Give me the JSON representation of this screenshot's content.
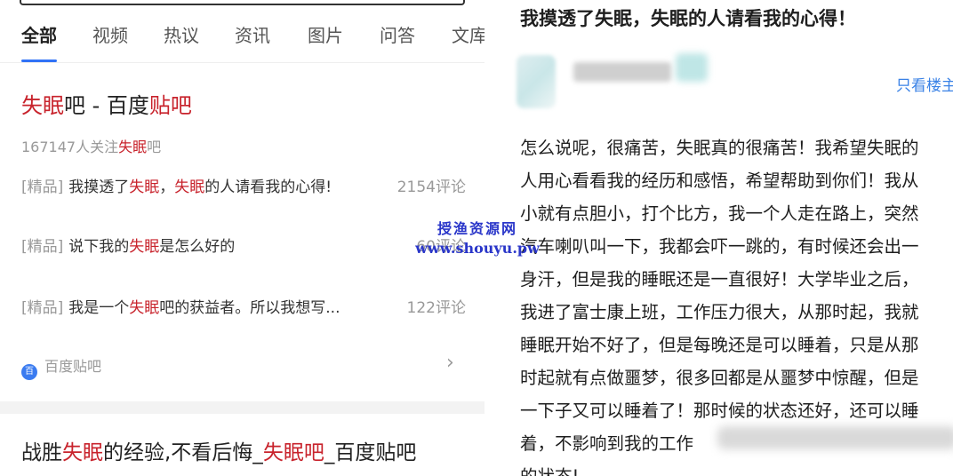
{
  "left": {
    "tabs": [
      "全部",
      "视频",
      "热议",
      "资讯",
      "图片",
      "问答",
      "文库"
    ],
    "result1": {
      "title": {
        "keyword": "失眠",
        "rest": "吧 - 百度",
        "highlight": "贴吧"
      },
      "followers": {
        "count_text": "167147人关注",
        "keyword": "失眠",
        "suffix": "吧"
      },
      "posts": [
        {
          "tag": "[精品]",
          "pre": "我摸透了",
          "kw1": "失眠",
          "mid": "，",
          "kw2": "失眠",
          "post": "的人请看我的心得!",
          "count": "2154评论"
        },
        {
          "tag": "[精品]",
          "pre": "说下我的",
          "kw1": "失眠",
          "mid": "",
          "kw2": "",
          "post": "是怎么好的",
          "count": "60评论"
        },
        {
          "tag": "[精品]",
          "pre": "我是一个",
          "kw1": "失眠",
          "mid": "",
          "kw2": "",
          "post": "吧的获益者。所以我想写...",
          "count": "122评论"
        }
      ],
      "source": "百度贴吧",
      "source_logo": "百"
    },
    "result2": {
      "p1": "战胜",
      "kw1": "失眠",
      "p2": "的经验,不看后悔_",
      "kw2": "失眠吧",
      "p3": "_百度贴吧"
    }
  },
  "right": {
    "title": "我摸透了失眠，失眠的人请看我的心得！",
    "only_op": "只看楼主",
    "lines": [
      "怎么说呢，很痛苦，失眠真的很痛苦！我希望失眠的",
      "人用心看看我的经历和感悟，希望帮助到你们！我从",
      "小就有点胆小，打个比方，我一个人走在路上，突然",
      "汽车喇叭叫一下，我都会吓一跳的，有时候还会出一",
      "身汗，但是我的睡眠还是一直很好！大学毕业之后，",
      "我进了富士康上班，工作压力很大，从那时起，我就",
      "睡眠开始不好了，但是每晚还是可以睡着，只是从那",
      "时起就有点做噩梦，很多回都是从噩梦中惊醒，但是",
      "一下子又可以睡着了！那时候的状态还好，还可以睡",
      "着，不影响到我的工作",
      "的状态!"
    ]
  },
  "watermark": {
    "name": "授渔资源网",
    "url": "www.shouyu.pw"
  }
}
